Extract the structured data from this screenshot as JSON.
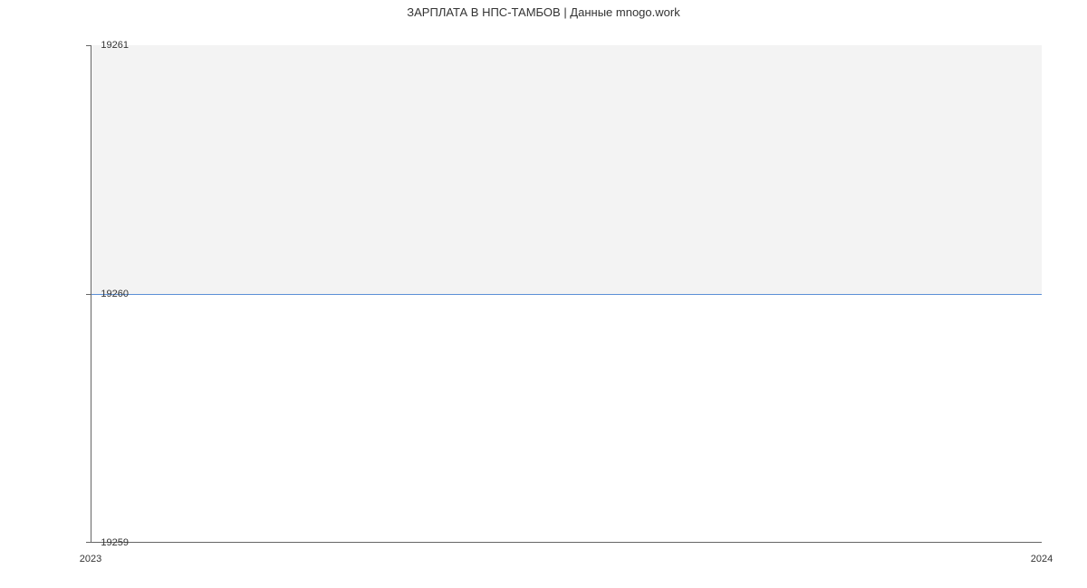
{
  "chart_data": {
    "type": "line",
    "title": "ЗАРПЛАТА В НПС-ТАМБОВ | Данные mnogo.work",
    "x": [
      2023,
      2024
    ],
    "values": [
      19260,
      19260
    ],
    "ylim": [
      19259,
      19261
    ],
    "xlim": [
      2023,
      2024
    ],
    "y_ticks": [
      19259,
      19260,
      19261
    ],
    "x_ticks": [
      2023,
      2024
    ],
    "line_color": "#5b8fd6"
  }
}
